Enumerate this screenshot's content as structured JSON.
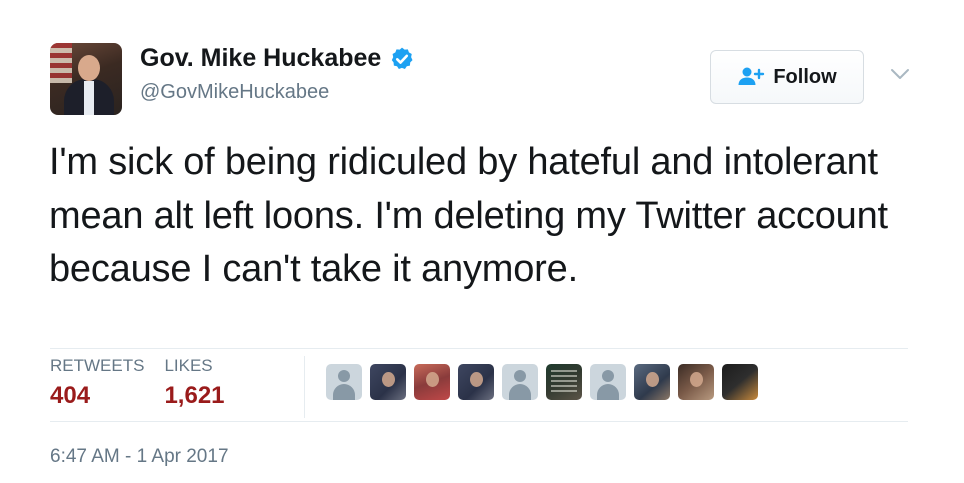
{
  "tweet": {
    "author": {
      "name": "Gov. Mike Huckabee",
      "handle": "@GovMikeHuckabee",
      "verified": true,
      "avatar": "profile-photo"
    },
    "follow_button": {
      "label": "Follow",
      "icon": "add-user-icon"
    },
    "menu_icon": "chevron-down-icon",
    "text": "I'm sick of being ridiculed by hateful and intolerant mean alt left loons. I'm deleting my Twitter account because I can't take it anymore.",
    "stats": {
      "retweets_label": "RETWEETS",
      "retweets_value": "404",
      "likes_label": "LIKES",
      "likes_value": "1,621"
    },
    "liked_by_avatars": [
      "default-avatar",
      "photo",
      "photo",
      "photo",
      "default-avatar",
      "photo",
      "default-avatar",
      "photo",
      "photo",
      "photo"
    ],
    "timestamp": "6:47 AM - 1 Apr 2017"
  },
  "colors": {
    "text": "#14171a",
    "secondary": "#657786",
    "stat_value": "#9a1b1b",
    "verified": "#1da1f2",
    "follow_icon": "#1da1f2",
    "divider": "#e6ecf0"
  }
}
